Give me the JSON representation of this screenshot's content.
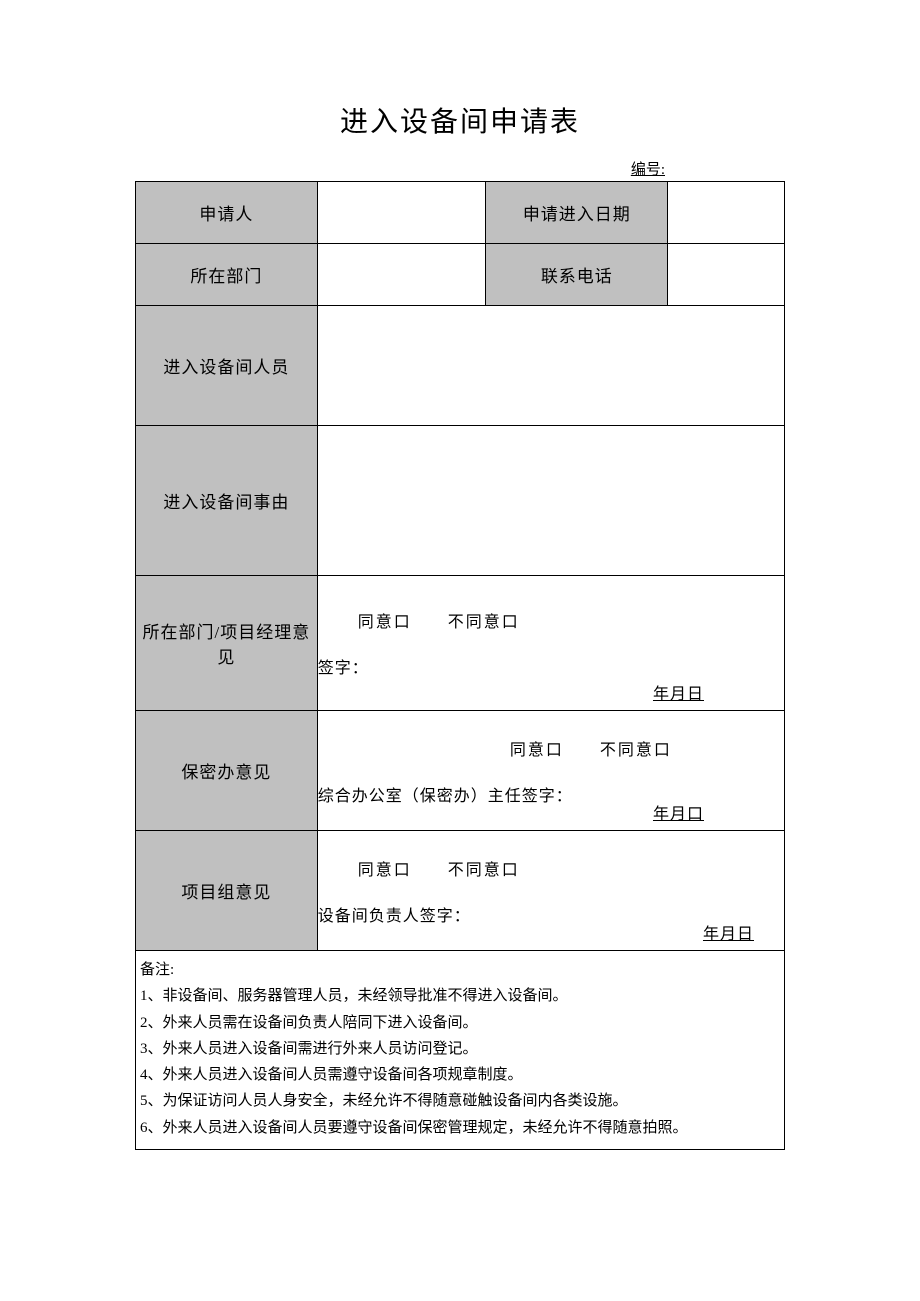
{
  "title": "进入设备间申请表",
  "serial_label": "编号:",
  "labels": {
    "applicant": "申请人",
    "apply_date": "申请进入日期",
    "department": "所在部门",
    "phone": "联系电话",
    "personnel": "进入设备间人员",
    "reason": "进入设备间事由",
    "dept_opinion": "所在部门/项目经理意见",
    "security_opinion": "保密办意见",
    "project_opinion": "项目组意见"
  },
  "opinion": {
    "agree": "同意口",
    "disagree": "不同意口",
    "sign": "签字：",
    "security_sign": "综合办公室（保密办）主任签字：",
    "project_sign": "设备间负责人签字：",
    "date": "年月日",
    "date2": "年月口"
  },
  "notes": {
    "title": "备注:",
    "items": [
      "1、非设备间、服务器管理人员，未经领导批准不得进入设备间。",
      "2、外来人员需在设备间负责人陪同下进入设备间。",
      "3、外来人员进入设备间需进行外来人员访问登记。",
      "4、外来人员进入设备间人员需遵守设备间各项规章制度。",
      "5、为保证访问人员人身安全，未经允许不得随意碰触设备间内各类设施。",
      "6、外来人员进入设备间人员要遵守设备间保密管理规定，未经允许不得随意拍照。"
    ]
  }
}
